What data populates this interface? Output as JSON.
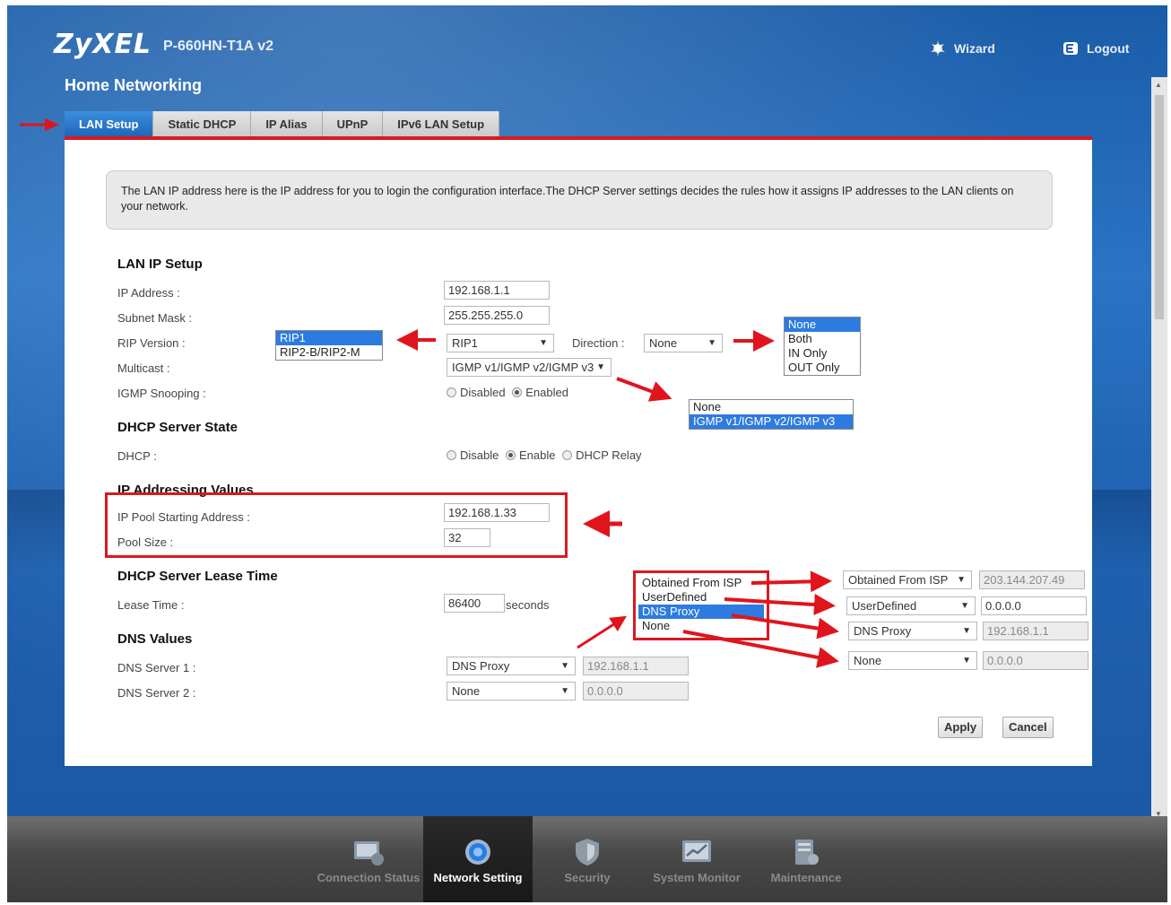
{
  "header": {
    "brand": "ZyXEL",
    "model": "P-660HN-T1A v2",
    "wizard_label": "Wizard",
    "logout_label": "Logout",
    "page_title": "Home Networking"
  },
  "tabs": [
    {
      "label": "LAN Setup",
      "active": true
    },
    {
      "label": "Static DHCP"
    },
    {
      "label": "IP Alias"
    },
    {
      "label": "UPnP"
    },
    {
      "label": "IPv6 LAN Setup"
    }
  ],
  "info_text": "The LAN IP address here is the IP address for you to login the configuration interface.The DHCP Server settings decides the rules how it assigns IP addresses to the LAN clients on your network.",
  "lan_ip_setup": {
    "title": "LAN IP Setup",
    "ip_address_label": "IP Address :",
    "ip_address": "192.168.1.1",
    "subnet_mask_label": "Subnet Mask :",
    "subnet_mask": "255.255.255.0",
    "rip_version_label": "RIP Version :",
    "rip_version": "RIP1",
    "rip_options": [
      "RIP1",
      "RIP2-B/RIP2-M"
    ],
    "direction_label": "Direction :",
    "direction": "None",
    "direction_options": [
      "None",
      "Both",
      "IN Only",
      "OUT Only"
    ],
    "multicast_label": "Multicast :",
    "multicast": "IGMP v1/IGMP v2/IGMP v3",
    "multicast_options": [
      "None",
      "IGMP v1/IGMP v2/IGMP v3"
    ],
    "igmp_snooping_label": "IGMP Snooping :",
    "igmp_disabled": "Disabled",
    "igmp_enabled": "Enabled"
  },
  "dhcp_state": {
    "title": "DHCP Server State",
    "dhcp_label": "DHCP :",
    "opt_disable": "Disable",
    "opt_enable": "Enable",
    "opt_relay": "DHCP Relay"
  },
  "ip_values": {
    "title": "IP Addressing Values",
    "pool_start_label": "IP Pool Starting Address :",
    "pool_start": "192.168.1.33",
    "pool_size_label": "Pool Size :",
    "pool_size": "32"
  },
  "lease": {
    "title": "DHCP Server Lease Time",
    "lease_label": "Lease Time :",
    "lease_value": "86400",
    "unit": "seconds"
  },
  "dns": {
    "title": "DNS Values",
    "server1_label": "DNS Server 1 :",
    "server1_type": "DNS Proxy",
    "server1_ip": "192.168.1.1",
    "server2_label": "DNS Server 2 :",
    "server2_type": "None",
    "server2_ip": "0.0.0.0",
    "options": [
      "Obtained From ISP",
      "UserDefined",
      "DNS Proxy",
      "None"
    ],
    "examples": [
      {
        "type": "Obtained From ISP",
        "ip": "203.144.207.49"
      },
      {
        "type": "UserDefined",
        "ip": "0.0.0.0"
      },
      {
        "type": "DNS Proxy",
        "ip": "192.168.1.1"
      },
      {
        "type": "None",
        "ip": "0.0.0.0"
      }
    ]
  },
  "buttons": {
    "apply": "Apply",
    "cancel": "Cancel"
  },
  "footer": [
    {
      "label": "Connection Status"
    },
    {
      "label": "Network Setting",
      "active": true
    },
    {
      "label": "Security"
    },
    {
      "label": "System Monitor"
    },
    {
      "label": "Maintenance"
    }
  ],
  "colors": {
    "accent": "#d71a20",
    "tab_active": "#1d63b6",
    "highlight": "#2d7be0"
  }
}
